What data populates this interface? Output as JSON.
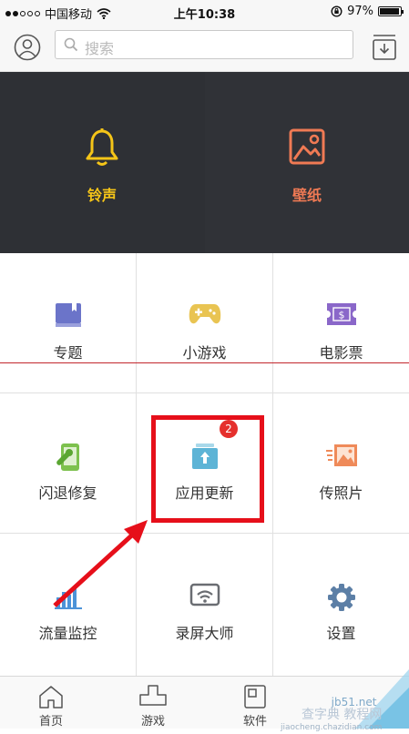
{
  "status_bar": {
    "carrier": "中国移动",
    "time": "上午10:38",
    "battery": "97%",
    "battery_level": 0.97,
    "signal_icon": "signal-dots-icon",
    "wifi_icon": "wifi-icon",
    "lock_icon": "rotation-lock-icon"
  },
  "header": {
    "search_placeholder": "搜索",
    "avatar_icon": "user-avatar-icon",
    "search_icon": "search-icon",
    "download_icon": "download-tray-icon"
  },
  "featured": [
    {
      "label": "铃声",
      "icon": "bell-icon",
      "color": "#f5c518"
    },
    {
      "label": "壁纸",
      "icon": "picture-frame-icon",
      "color": "#f07a54"
    }
  ],
  "grid": [
    {
      "label": "专题",
      "icon": "book-icon",
      "color": "#6b74c9"
    },
    {
      "label": "小游戏",
      "icon": "gamepad-icon",
      "color": "#e9c452"
    },
    {
      "label": "电影票",
      "icon": "ticket-icon",
      "color": "#8a67c9"
    },
    {
      "label": "闪退修复",
      "icon": "phone-wrench-icon",
      "color": "#7dc14e"
    },
    {
      "label": "应用更新",
      "icon": "update-upload-icon",
      "color": "#5db4d6",
      "badge": "2"
    },
    {
      "label": "传照片",
      "icon": "photo-send-icon",
      "color": "#ef8a59"
    },
    {
      "label": "流量监控",
      "icon": "bar-chart-icon",
      "color": "#4c93d8"
    },
    {
      "label": "录屏大师",
      "icon": "screen-cast-icon",
      "color": "#6a6d72"
    },
    {
      "label": "设置",
      "icon": "gear-icon",
      "color": "#5c7fa6"
    }
  ],
  "tabs": [
    {
      "label": "首页",
      "icon": "home-icon"
    },
    {
      "label": "游戏",
      "icon": "game-tab-icon"
    },
    {
      "label": "软件",
      "icon": "apps-tab-icon"
    },
    {
      "label": "",
      "icon": "hidden-tab-icon"
    }
  ],
  "watermark": {
    "line1": "查字典 教程网",
    "line2": "jiaocheng.chazidian.com",
    "line3": "jb51.net"
  }
}
